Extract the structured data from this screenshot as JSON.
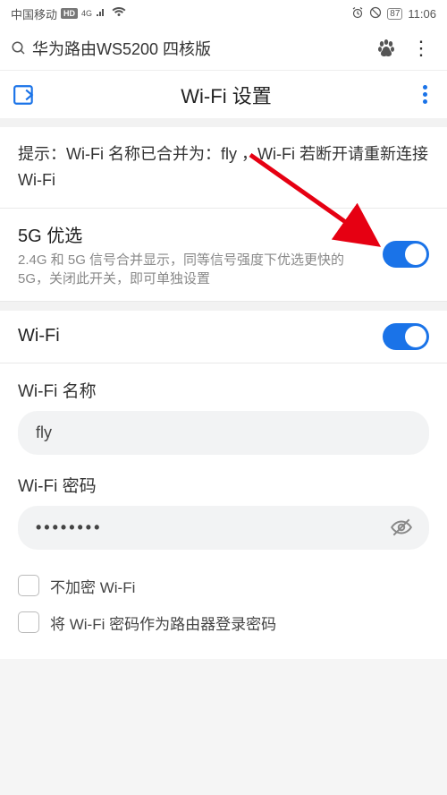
{
  "status": {
    "carrier": "中国移动",
    "hd": "HD",
    "net": "4G",
    "battery": "87",
    "time": "11:06"
  },
  "search": {
    "query": "华为路由WS5200 四核版"
  },
  "title": "Wi-Fi 设置",
  "hint": "提示：Wi-Fi 名称已合并为：fly ，Wi-Fi 若断开请重新连接 Wi-Fi",
  "prefer5g": {
    "title": "5G 优选",
    "desc": "2.4G 和 5G 信号合并显示，同等信号强度下优选更快的 5G，关闭此开关，即可单独设置"
  },
  "wifiRow": {
    "title": "Wi-Fi"
  },
  "form": {
    "nameLabel": "Wi-Fi 名称",
    "nameValue": "fly",
    "pwdLabel": "Wi-Fi 密码",
    "pwdValue": "••••••••",
    "noEncrypt": "不加密 Wi-Fi",
    "useAsLogin": "将 Wi-Fi 密码作为路由器登录密码"
  },
  "colors": {
    "accent": "#1a73e8",
    "arrow": "#e60012"
  }
}
